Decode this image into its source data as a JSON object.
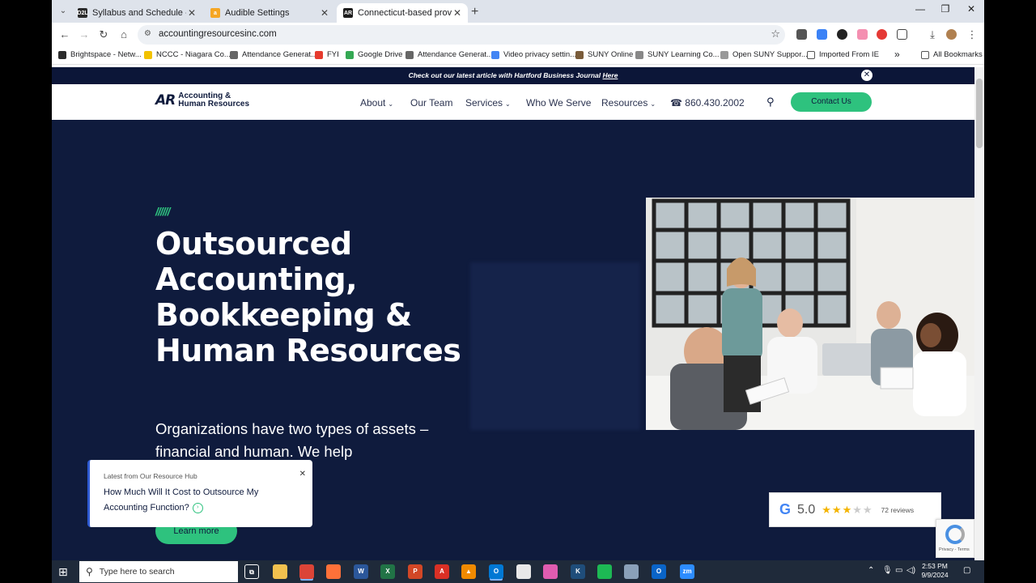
{
  "browser": {
    "tabs": [
      {
        "title": "Syllabus and Schedule - PRACTI",
        "favicon_color": "#2b2b2b",
        "favicon_text": "D2L",
        "active": false
      },
      {
        "title": "Audible Settings",
        "favicon_color": "#f5a623",
        "favicon_text": "a",
        "active": false
      },
      {
        "title": "Connecticut-based provider of",
        "favicon_color": "#1c1c1c",
        "favicon_text": "AR",
        "active": true
      }
    ],
    "tab_close": "✕",
    "new_tab": "+",
    "window_controls": {
      "minimize": "—",
      "maximize": "❐",
      "close": "✕"
    },
    "url": "accountingresourcesinc.com",
    "bookmarks": [
      {
        "label": "Brightspace - Netw...",
        "color": "#2b2b2b"
      },
      {
        "label": "NCCC - Niagara Co...",
        "color": "#f2c200"
      },
      {
        "label": "Attendance Generat...",
        "color": "#666666"
      },
      {
        "label": "FYI",
        "color": "#e63b2e"
      },
      {
        "label": "Google Drive",
        "color": "#34a853"
      },
      {
        "label": "Attendance Generat...",
        "color": "#666666"
      },
      {
        "label": "Video privacy settin...",
        "color": "#4285f4"
      },
      {
        "label": "SUNY Online",
        "color": "#7a5c3a"
      },
      {
        "label": "SUNY Learning Co...",
        "color": "#888888"
      },
      {
        "label": "Open SUNY Suppor...",
        "color": "#999999"
      },
      {
        "label": "Imported From IE",
        "color": "#ffffff"
      }
    ],
    "bookmarks_more": "»",
    "all_bookmarks": "All Bookmarks"
  },
  "site": {
    "announcement": {
      "text": "Check out our latest article with Hartford Business Journal ",
      "link": "Here",
      "close": "✕"
    },
    "logo": {
      "mark": "AR",
      "line1": "Accounting &",
      "line2": "Human Resources"
    },
    "nav": [
      {
        "label": "About",
        "has_menu": true
      },
      {
        "label": "Our Team",
        "has_menu": false
      },
      {
        "label": "Services",
        "has_menu": true
      },
      {
        "label": "Who We Serve",
        "has_menu": false
      },
      {
        "label": "Resources",
        "has_menu": true
      }
    ],
    "menu_chevron": "⌄",
    "phone": "860.430.2002",
    "contact_label": "Contact Us",
    "hero": {
      "stripes": "//////",
      "title": "Outsourced Accounting, Bookkeeping & Human Resources",
      "subtitle": "Organizations have two types of assets – financial and human. We help",
      "cta": "Learn more"
    },
    "resource_card": {
      "kicker": "Latest from Our Resource Hub",
      "title": "How Much Will It Cost to Outsource My Accounting Function?",
      "arrow": "›",
      "close": "✕"
    },
    "reviews": {
      "logo": "G",
      "score": "5.0",
      "rating": 3,
      "max": 5,
      "count": "72 reviews"
    },
    "recaptcha": {
      "terms": "Privacy - Terms"
    }
  },
  "taskbar": {
    "search_placeholder": "Type here to search",
    "apps": [
      {
        "name": "task-view",
        "color": "#1f2a3a",
        "glyph": "⧉"
      },
      {
        "name": "file-explorer",
        "color": "#f2c14e",
        "glyph": ""
      },
      {
        "name": "chrome",
        "color": "#db4437",
        "glyph": "",
        "active": true
      },
      {
        "name": "firefox",
        "color": "#ff7139",
        "glyph": ""
      },
      {
        "name": "word",
        "color": "#2b579a",
        "glyph": "W"
      },
      {
        "name": "excel",
        "color": "#217346",
        "glyph": "X"
      },
      {
        "name": "powerpoint",
        "color": "#d24726",
        "glyph": "P"
      },
      {
        "name": "acrobat",
        "color": "#d93025",
        "glyph": "A"
      },
      {
        "name": "vlc",
        "color": "#f08a00",
        "glyph": "▲"
      },
      {
        "name": "outlook",
        "color": "#0078d4",
        "glyph": "O",
        "active": true
      },
      {
        "name": "notepad",
        "color": "#e8e8e8",
        "glyph": ""
      },
      {
        "name": "app-colorful",
        "color": "#e05cb0",
        "glyph": ""
      },
      {
        "name": "kodi",
        "color": "#1f4d7a",
        "glyph": "K"
      },
      {
        "name": "spotify",
        "color": "#1db954",
        "glyph": ""
      },
      {
        "name": "app-cloud",
        "color": "#8aa0b8",
        "glyph": ""
      },
      {
        "name": "outlook-2",
        "color": "#0a64c8",
        "glyph": "O"
      },
      {
        "name": "zoom",
        "color": "#2d8cff",
        "glyph": "zm"
      }
    ],
    "time": "2:53 PM",
    "date": "9/9/2024"
  },
  "colors": {
    "navy": "#0f1b3d",
    "green": "#2ec27e",
    "star": "#f4b400"
  }
}
